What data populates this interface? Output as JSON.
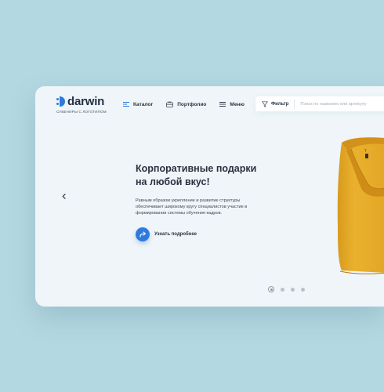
{
  "brand": {
    "name": "darwin",
    "tagline": "СУВЕНИРЫ С ЛОГОТИПОМ",
    "accent": "#2e7bde"
  },
  "nav": {
    "items": [
      {
        "label": "Каталог",
        "icon": "catalog-lines-icon"
      },
      {
        "label": "Портфолио",
        "icon": "briefcase-icon"
      },
      {
        "label": "Меню",
        "icon": "menu-icon"
      }
    ]
  },
  "search": {
    "filter_label": "Фильтр",
    "filter_icon": "funnel-icon",
    "placeholder": "Поиск по названию или артикулу"
  },
  "hero": {
    "title_line1": "Корпоративные подарки",
    "title_line2": "на любой вкус!",
    "text": "Равным образом укрепление и развитие структуры обеспечивает широкому кругу специалистов участие в формировании системы обучения кадров.",
    "cta_label": "Узнать подробнее",
    "cta_icon": "forward-arrow-icon"
  },
  "slider": {
    "prev_icon": "chevron-left-icon",
    "dots_count": 4,
    "active_index": 0
  },
  "colors": {
    "background": "#b4d8e1",
    "card": "#eff5f8",
    "shirt": "#e8ae2b"
  }
}
